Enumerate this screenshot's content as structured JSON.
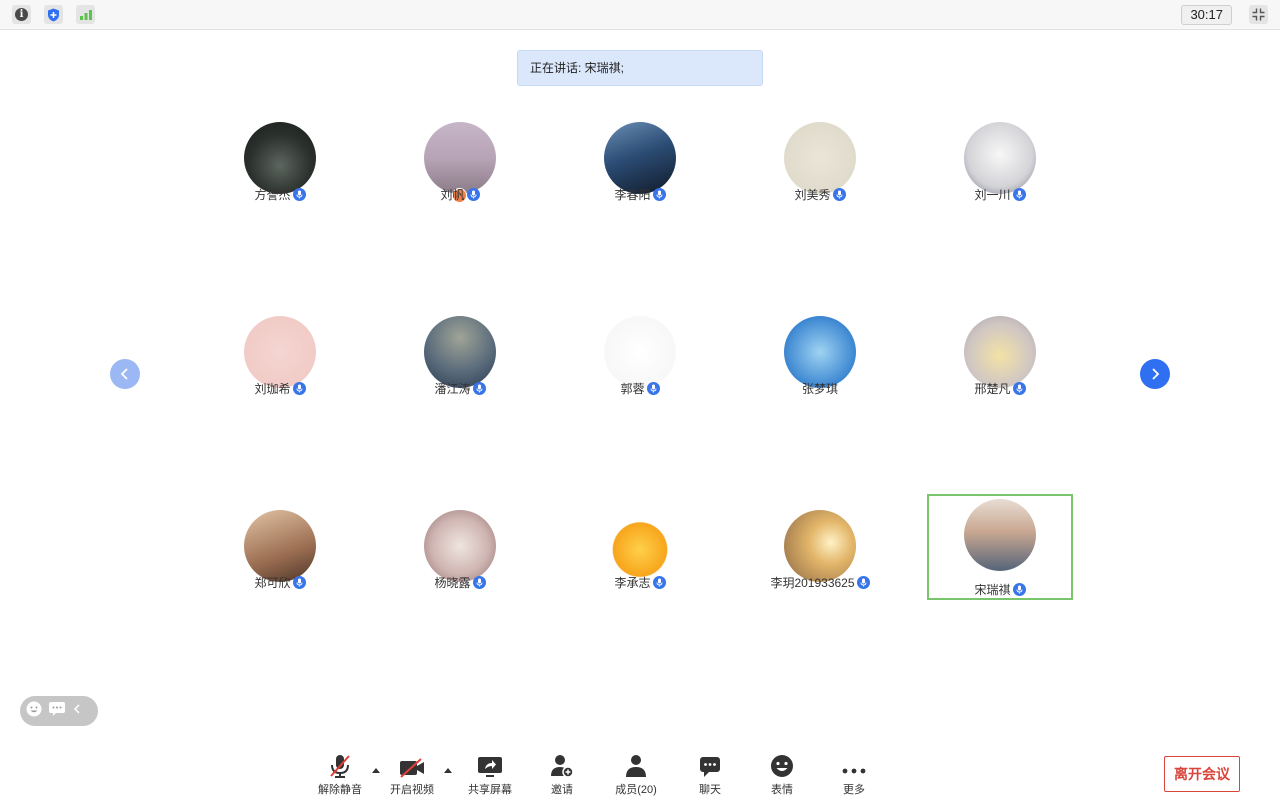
{
  "topbar": {
    "timer": "30:17",
    "icons": [
      "info-icon",
      "security-shield-icon",
      "network-signal-icon",
      "exit-fullscreen-icon"
    ]
  },
  "speaking": {
    "text": "正在讲话: 宋瑞祺;"
  },
  "participants": [
    {
      "name": "方誉杰",
      "mic": true
    },
    {
      "name": "刘帆",
      "mic": true,
      "host": true
    },
    {
      "name": "李春阳",
      "mic": true
    },
    {
      "name": "刘美秀",
      "mic": true
    },
    {
      "name": "刘一川",
      "mic": true
    },
    {
      "name": "刘珈希",
      "mic": true
    },
    {
      "name": "潘江涛",
      "mic": true
    },
    {
      "name": "郭蓉",
      "mic": true
    },
    {
      "name": "张梦琪",
      "mic": false
    },
    {
      "name": "邢楚凡",
      "mic": true
    },
    {
      "name": "郑可欣",
      "mic": true
    },
    {
      "name": "杨晓露",
      "mic": true
    },
    {
      "name": "李承志",
      "mic": true
    },
    {
      "name": "李玥201933625",
      "mic": true
    },
    {
      "name": "宋瑞祺",
      "mic": true,
      "speaking": true
    }
  ],
  "toolbar": {
    "unmute": "解除静音",
    "start_video": "开启视频",
    "share_screen": "共享屏幕",
    "invite": "邀请",
    "members": "成员(20)",
    "chat": "聊天",
    "reactions": "表情",
    "more": "更多",
    "leave": "离开会议"
  },
  "colors": {
    "accent": "#2f6ff2",
    "speaking_border": "#78c56b",
    "leave_red": "#d9443b",
    "banner_bg": "#dbe7fb"
  }
}
